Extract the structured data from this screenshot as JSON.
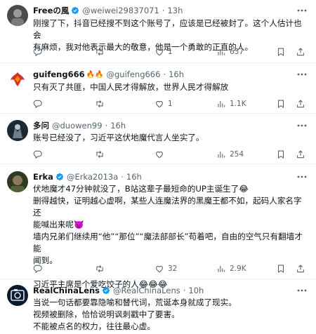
{
  "tweets": [
    {
      "name": "Freeの風",
      "handle": "@weiwei29837071",
      "dot": "·",
      "time": "13h",
      "verified": true,
      "lines": [
        "刚搜了下，抖音已经搜不到这个账号了，应该是已经被封了。这个人估计也会",
        "有麻烦，我对他表示最大的敬意，他是一个勇敢的正直的人。"
      ],
      "reply_count": "",
      "retweet_count": "",
      "like_count": "1",
      "view_count": "637"
    },
    {
      "name": "guifeng666",
      "name_emojis": "🔥🔥",
      "handle": "@guifeng666",
      "dot": "·",
      "time": "16h",
      "verified": false,
      "lines": [
        "只有灭了共匪，中国人民才得解放，世界人民才得解放"
      ],
      "reply_count": "",
      "retweet_count": "",
      "like_count": "1",
      "view_count": "1.1K"
    },
    {
      "name": "多问",
      "handle": "@duowen99",
      "dot": "·",
      "time": "16h",
      "verified": false,
      "lines": [
        "账号已经没了，习近平这伏地魔代言人坐实了。"
      ],
      "reply_count": "",
      "retweet_count": "",
      "like_count": "",
      "view_count": "254"
    },
    {
      "name": "Erka",
      "handle": "@Erka2013a",
      "dot": "·",
      "time": "16h",
      "verified": true,
      "lines": [
        "伏地魔才47分钟就没了，B站这辈子最短命的UP主诞生了😂",
        "删得越快，证明越心虚啊，某些人连魔法界的黑魔王都不如，起码人家名字还",
        "能喊出来呢👿",
        "墙内兄弟们继续用“他”“那位”“魔法部部长”苟着吧，自由的空气只有翻墙才能",
        "闻到。",
        "",
        "习近平主席是个爱吃饺子的人😂😂😂"
      ],
      "reply_count": "",
      "retweet_count": "",
      "like_count": "32",
      "view_count": "2.9K"
    },
    {
      "name": "RealChinaLens",
      "handle": "@RealChinaLens",
      "dot": "·",
      "time": "10h",
      "verified": true,
      "lines": [
        "当说一句话都要靠隐喻和替代词，荒诞本身就成了现实。",
        "视频被删除，恰恰说明讽刺戳中了要害。",
        "不能被点名的权力，往往最心虚。"
      ]
    }
  ],
  "colors": {
    "text": "#0f1419",
    "secondary": "#536471",
    "verified": "#1d9bf0",
    "divider": "#eff3f4"
  },
  "icons": [
    "more-icon",
    "reply-icon",
    "retweet-icon",
    "like-icon",
    "views-icon",
    "bookmark-icon",
    "share-icon",
    "verified-icon"
  ]
}
